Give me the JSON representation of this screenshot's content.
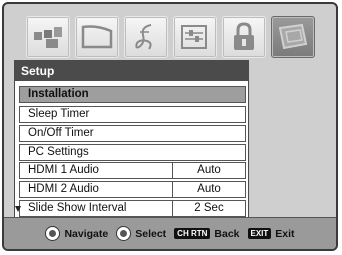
{
  "tabs": [
    {
      "icon": "picture-icon",
      "active": false
    },
    {
      "icon": "widescreen-icon",
      "active": false
    },
    {
      "icon": "music-note-icon",
      "active": false
    },
    {
      "icon": "preferences-icon",
      "active": false
    },
    {
      "icon": "lock-icon",
      "active": false
    },
    {
      "icon": "setup-icon",
      "active": true
    }
  ],
  "menu": {
    "title": "Setup",
    "items": [
      {
        "label": "Installation",
        "value": "",
        "highlighted": true
      },
      {
        "label": "Sleep Timer",
        "value": ""
      },
      {
        "label": "On/Off Timer",
        "value": ""
      },
      {
        "label": "PC Settings",
        "value": ""
      },
      {
        "label": "HDMI 1 Audio",
        "value": "Auto"
      },
      {
        "label": "HDMI 2 Audio",
        "value": "Auto"
      },
      {
        "label": "Slide Show Interval",
        "value": "2 Sec"
      }
    ]
  },
  "footer": {
    "navigate": "Navigate",
    "select": "Select",
    "back_key": "CH RTN",
    "back": "Back",
    "exit_key": "EXIT",
    "exit": "Exit"
  }
}
